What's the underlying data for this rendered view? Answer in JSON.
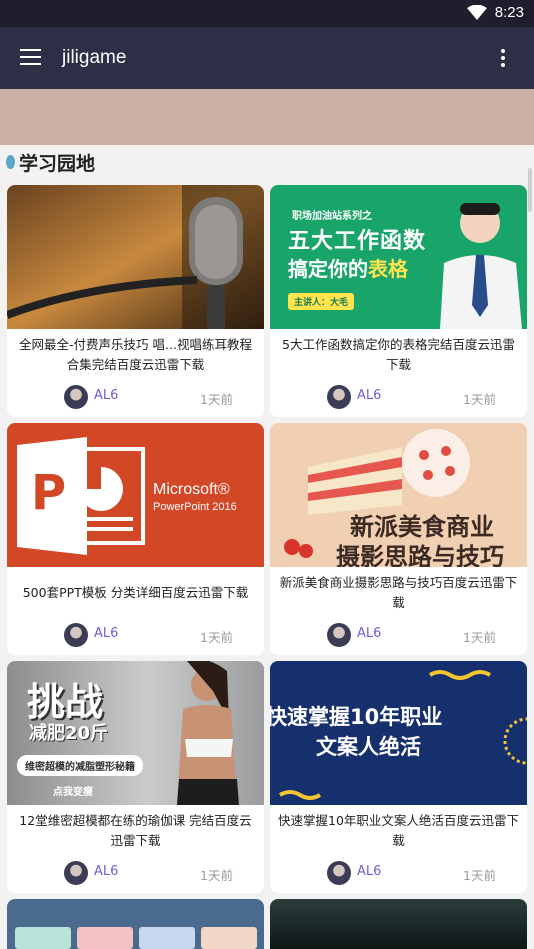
{
  "status": {
    "time": "8:23"
  },
  "app_bar": {
    "title": "jiligame"
  },
  "section": {
    "title": "学习园地"
  },
  "cards": [
    {
      "title": "全网最全-付费声乐技巧 唱...视唱练耳教程合集完结百度云迅雷下载",
      "author": "AL6",
      "time": "1天前",
      "cover": {}
    },
    {
      "title": "5大工作函数搞定你的表格完结百度云迅雷下载",
      "author": "AL6",
      "time": "1天前",
      "cover": {
        "series": "职场加油站系列之",
        "line1": "五大工作函数",
        "line2_a": "搞定你的",
        "line2_b": "表格",
        "speaker": "主讲人：大毛"
      }
    },
    {
      "title": "500套PPT模板 分类详细百度云迅雷下载",
      "author": "AL6",
      "time": "1天前",
      "cover": {
        "brand": "Microsoft®",
        "product": "PowerPoint 2016",
        "letter": "P"
      }
    },
    {
      "title": "新派美食商业摄影思路与技巧百度云迅雷下载",
      "author": "AL6",
      "time": "1天前",
      "cover": {
        "line1": "新派美食商业",
        "line2": "摄影思路与技巧"
      }
    },
    {
      "title": "12堂维密超模都在练的瑜伽课 完结百度云迅雷下载",
      "author": "AL6",
      "time": "1天前",
      "cover": {
        "big": "挑战",
        "sub": "减肥20斤",
        "ribbon": "维密超模的减脂塑形秘籍",
        "cta": "点我变瘦"
      }
    },
    {
      "title": "快速掌握10年职业文案人绝活百度云迅雷下载",
      "author": "AL6",
      "time": "1天前",
      "cover": {
        "line1": "快速掌握10年职业",
        "line2": "文案人绝活"
      }
    }
  ],
  "colors": {
    "app_bar": "#2c2f46",
    "status_bar": "#1e1e2c",
    "author": "#6d5fd1",
    "banner": "#cbb1a5"
  },
  "icons": [
    "menu-icon",
    "more-vert-icon",
    "wifi-icon",
    "avatar"
  ]
}
